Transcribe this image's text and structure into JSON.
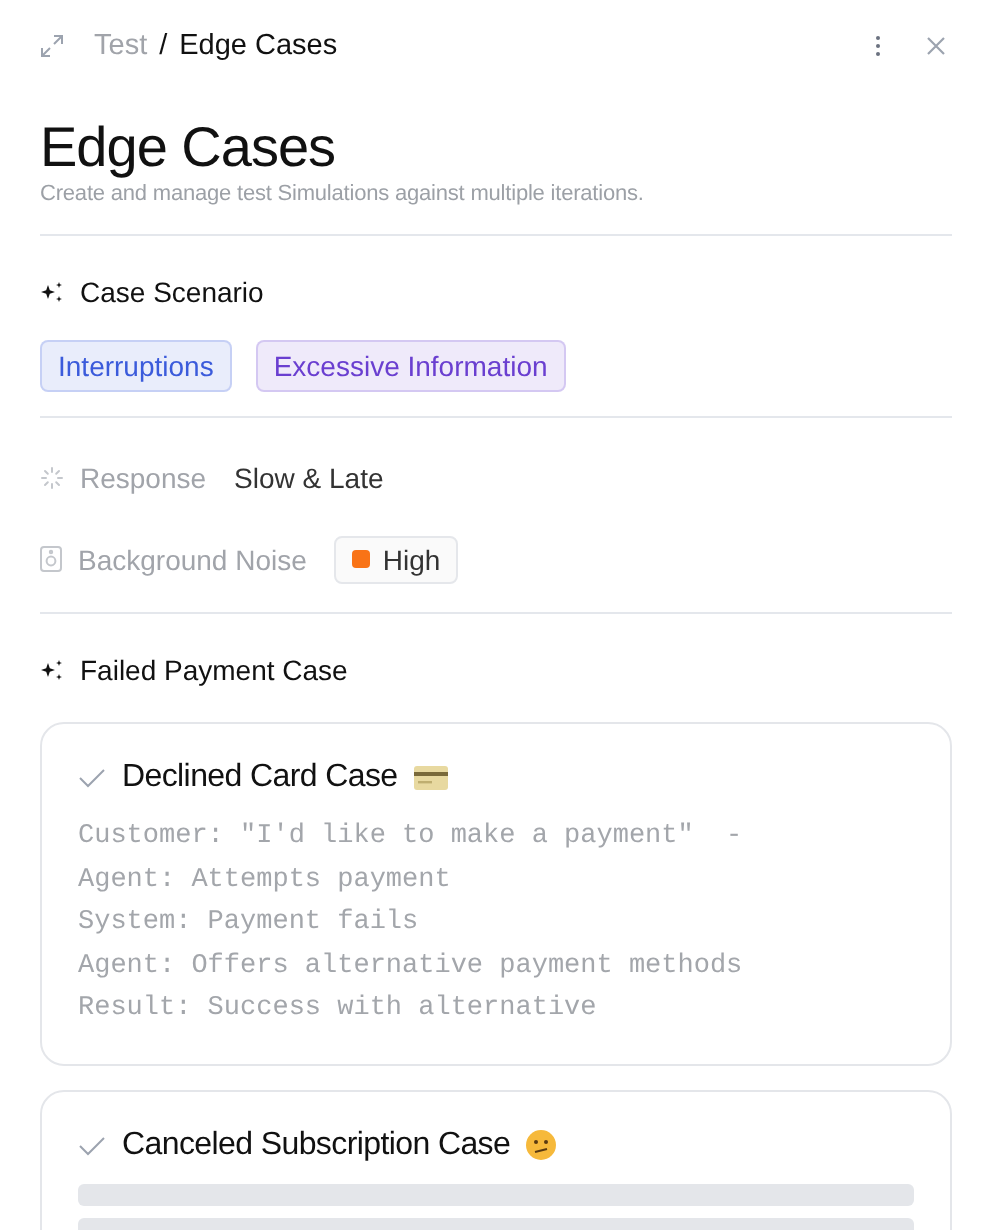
{
  "breadcrumb": {
    "parent": "Test",
    "separator": "/",
    "current": "Edge Cases"
  },
  "title": "Edge Cases",
  "subtitle": "Create and manage test Simulations against multiple iterations.",
  "scenario": {
    "label": "Case Scenario",
    "tags": [
      {
        "label": "Interruptions",
        "color": "#3b5bdb"
      },
      {
        "label": "Excessive Information",
        "color": "#6a3fd0"
      }
    ]
  },
  "properties": [
    {
      "kind": "text",
      "label": "Response",
      "value": "Slow & Late"
    },
    {
      "kind": "level",
      "label": "Background Noise",
      "value": "High",
      "color": "#f97316"
    }
  ],
  "cases_section": {
    "label": "Failed Payment Case"
  },
  "cases": [
    {
      "kind": "script",
      "title": "Declined Card Case",
      "lines": [
        "Customer: \"I'd like to make a payment\"  -",
        "Agent: Attempts payment",
        "System: Payment fails",
        "Agent: Offers alternative payment methods",
        "Result: Success with alternative"
      ]
    },
    {
      "kind": "loading",
      "title": "Canceled Subscription Case"
    }
  ]
}
